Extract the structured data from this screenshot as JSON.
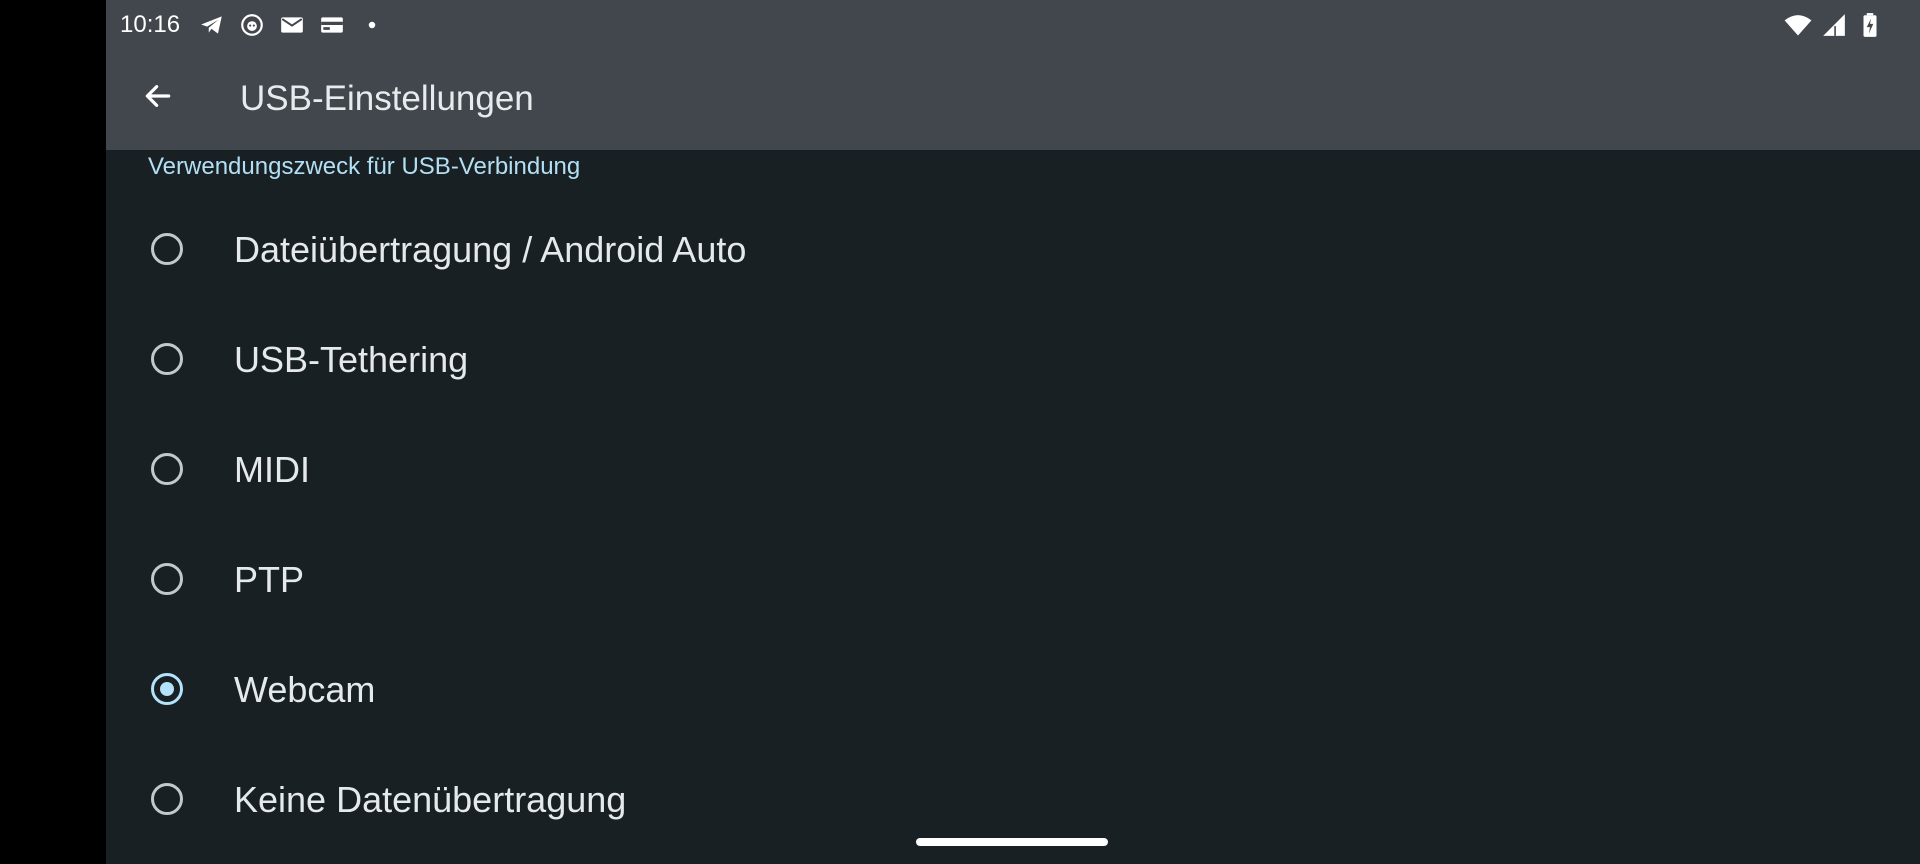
{
  "status_bar": {
    "time": "10:16",
    "left_icons": [
      "telegram-icon",
      "bot-app-icon",
      "mail-icon",
      "wallet-icon",
      "more-notifications-dot-icon"
    ],
    "right_icons": [
      "wifi-icon",
      "cell-signal-icon",
      "battery-charging-icon"
    ]
  },
  "app_bar": {
    "back_icon": "arrow-back-icon",
    "title": "USB-Einstellungen"
  },
  "section": {
    "header": "Verwendungszweck für USB-Verbindung"
  },
  "options": [
    {
      "label": "Dateiübertragung / Android Auto",
      "selected": false
    },
    {
      "label": "USB-Tethering",
      "selected": false
    },
    {
      "label": "MIDI",
      "selected": false
    },
    {
      "label": "PTP",
      "selected": false
    },
    {
      "label": "Webcam",
      "selected": true
    },
    {
      "label": "Keine Datenübertragung",
      "selected": false
    }
  ],
  "colors": {
    "background": "#192024",
    "app_bar": "#41474d",
    "accent": "#b3e2fa",
    "section_header": "#b3dff5",
    "text": "#e5e9eb"
  }
}
